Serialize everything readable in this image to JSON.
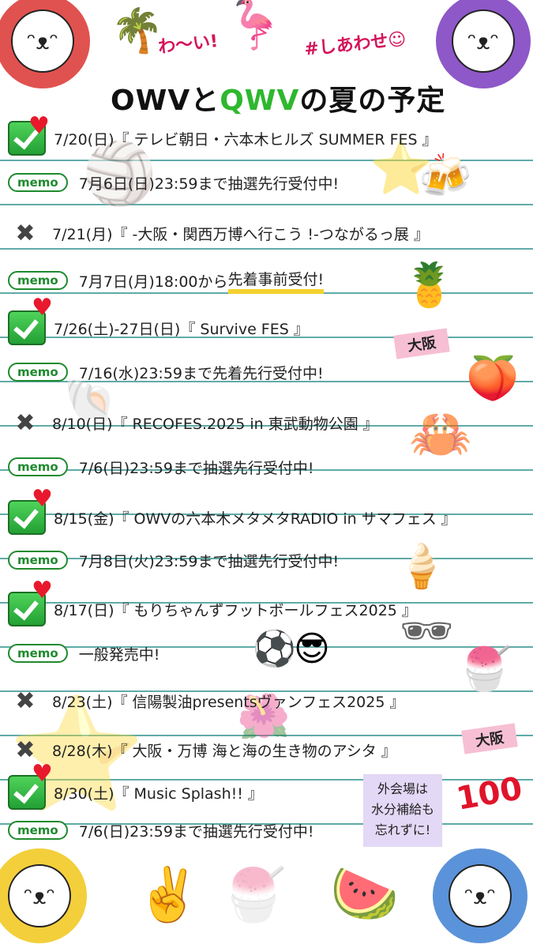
{
  "header": {
    "title_a": "OWV",
    "title_b": "と",
    "title_c": "QWV",
    "title_d": "の夏の予定",
    "tag_left": "わ〜い!",
    "tag_right": "#しあわせ☺"
  },
  "schedule": [
    {
      "status": "checked",
      "text": "7/20(日)『 テレビ朝日・六本木ヒルズ SUMMER FES 』"
    },
    {
      "status": "memo",
      "memo_label": "memo",
      "text": "7月6日(日)23:59まで抽選先行受付中!"
    },
    {
      "status": "cross",
      "text": "7/21(月)『 -大阪・関西万博へ行こう !-つながるっ展 』"
    },
    {
      "status": "memo",
      "memo_label": "memo",
      "text_a": "7月7日(月)18:00から",
      "text_b": "先着事前受付!"
    },
    {
      "status": "checked",
      "text": "7/26(土)-27日(日)『 Survive FES 』"
    },
    {
      "status": "memo",
      "memo_label": "memo",
      "text": "7/16(水)23:59まで先着先行受付中!"
    },
    {
      "status": "cross",
      "text": "8/10(日)『 RECOFES.2025 in 東武動物公園 』"
    },
    {
      "status": "memo",
      "memo_label": "memo",
      "text": "7/6(日)23:59まで抽選先行受付中!"
    },
    {
      "status": "checked",
      "text": "8/15(金)『 OWVの六本木メタメタRADIO in サマフェス 』"
    },
    {
      "status": "memo",
      "memo_label": "memo",
      "text": "7月8日(火)23:59まで抽選先行受付中!"
    },
    {
      "status": "checked",
      "text": "8/17(日)『 もりちゃんずフットボールフェス2025 』"
    },
    {
      "status": "memo",
      "memo_label": "memo",
      "text": "一般発売中!"
    },
    {
      "status": "cross",
      "text": "8/23(土)『 信陽製油presentsヴァンフェス2025 』"
    },
    {
      "status": "cross",
      "text": "8/28(木)『 大阪・万博 海と海の生き物のアシタ 』"
    },
    {
      "status": "checked",
      "text": "8/30(土)『 Music Splash!! 』"
    },
    {
      "status": "memo",
      "memo_label": "memo",
      "text": "7/6(日)23:59まで抽選先行受付中!"
    }
  ],
  "ribbons": {
    "osaka_1": "大阪",
    "osaka_2": "大阪"
  },
  "note": {
    "line1": "外会場は",
    "line2": "水分補給も",
    "line3": "忘れずに!"
  },
  "hundred": "100",
  "icons": {
    "check": "check-mark-icon",
    "cross": "cross-mark-icon",
    "heart": "heart-icon"
  },
  "colors": {
    "accent_green": "#2eb82e",
    "rule_teal": "#2a8f8a",
    "heart_red": "#e8192c"
  }
}
